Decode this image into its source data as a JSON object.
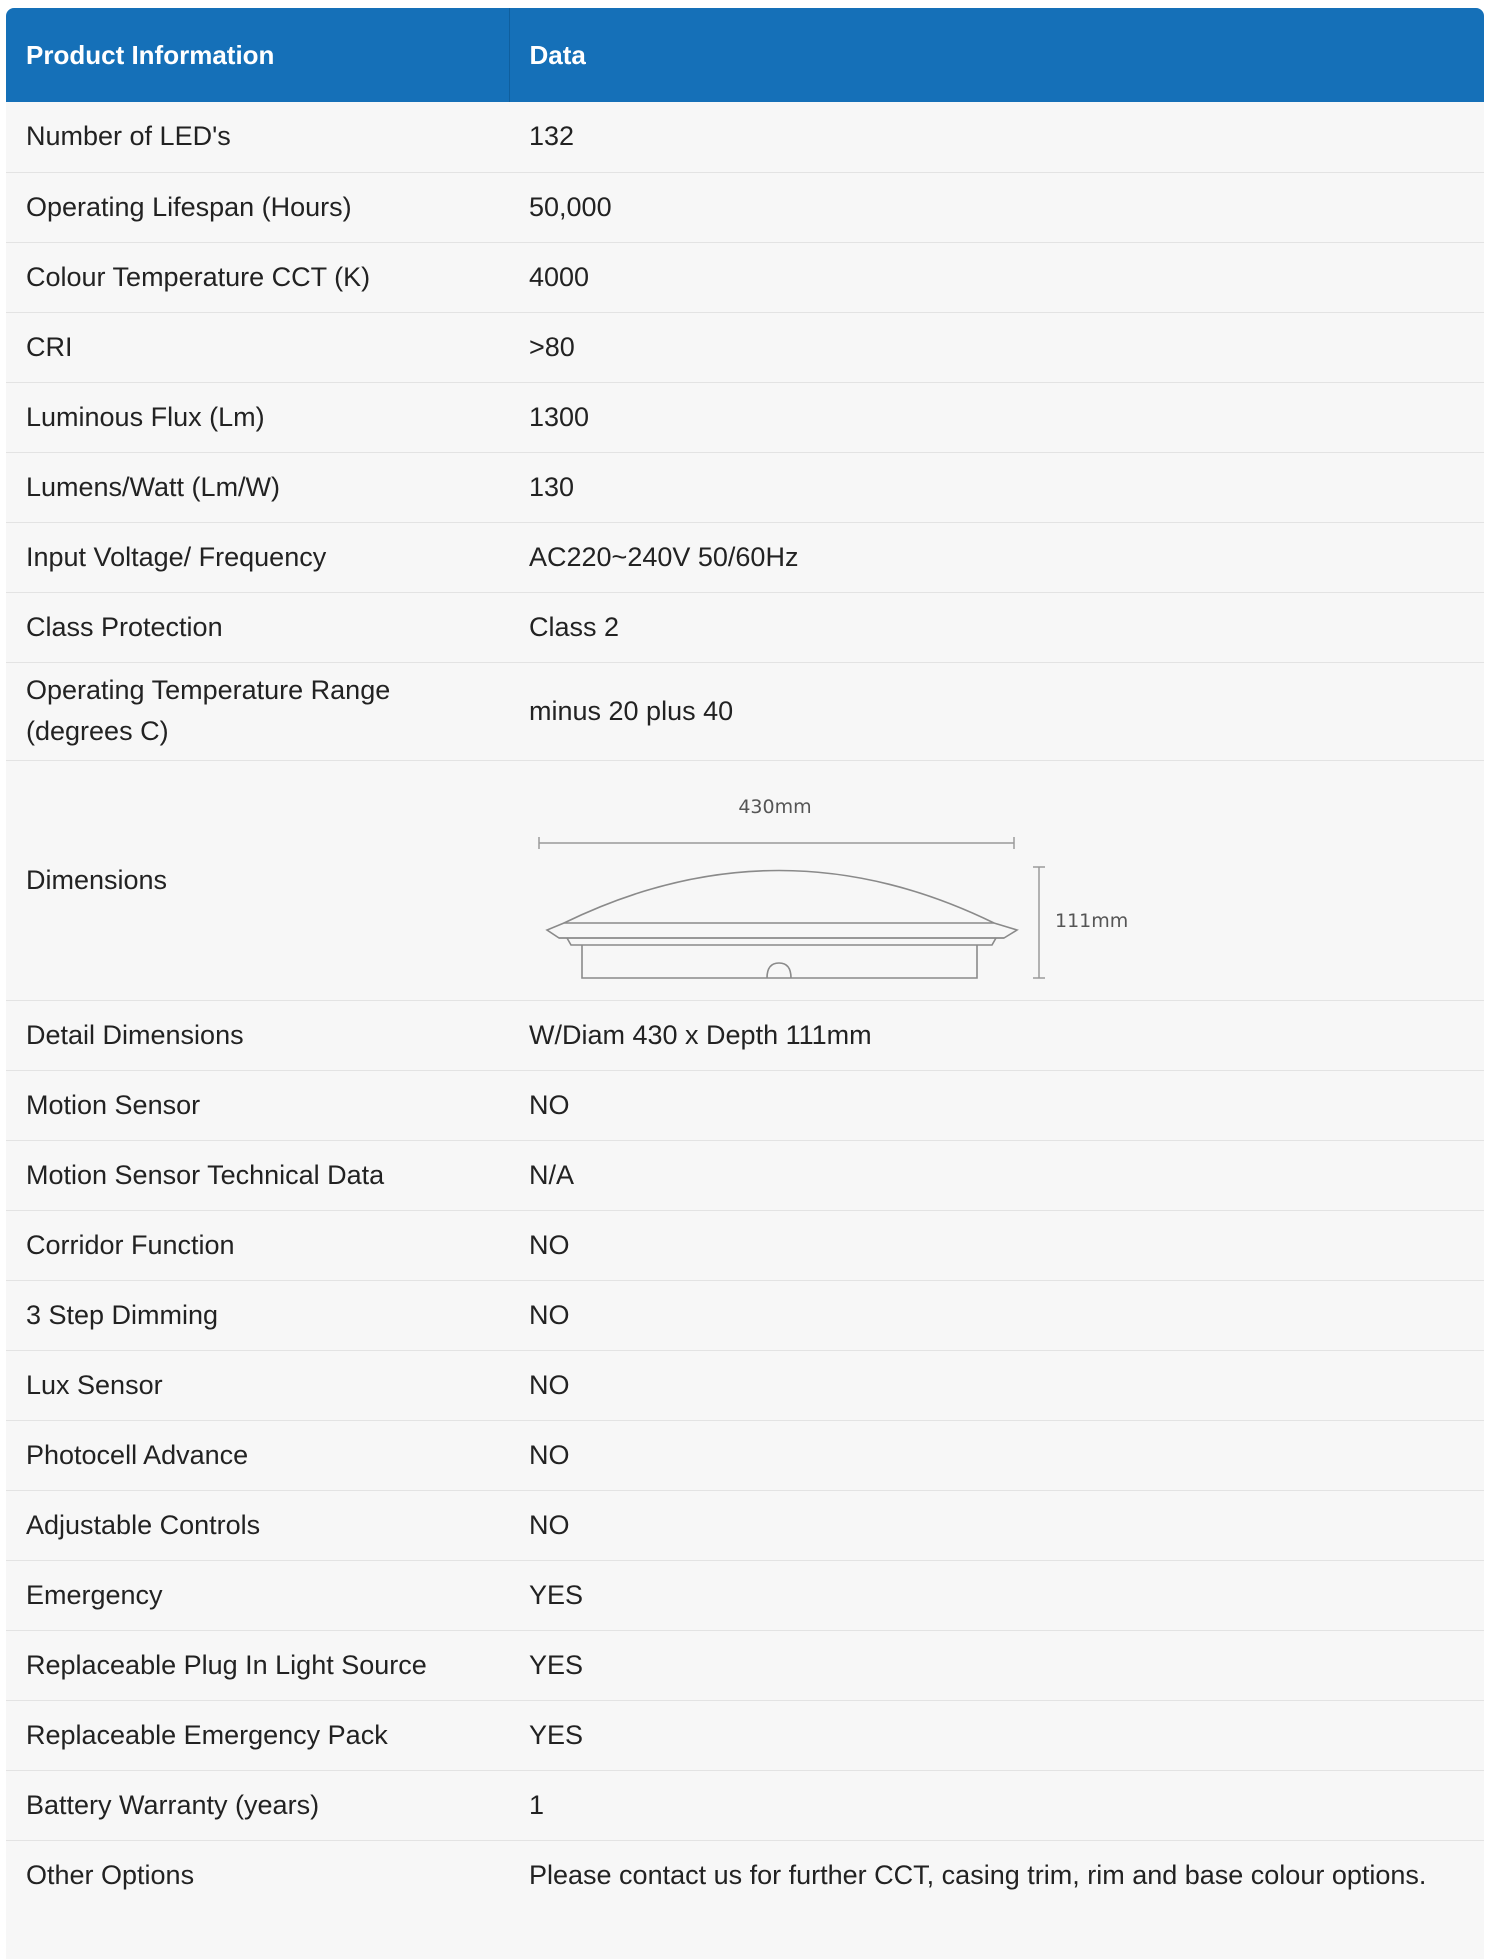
{
  "header": {
    "col1": "Product Information",
    "col2": "Data"
  },
  "rows": [
    {
      "label": "Number of LED's",
      "value": "132"
    },
    {
      "label": "Operating Lifespan (Hours)",
      "value": "50,000"
    },
    {
      "label": "Colour Temperature CCT (K)",
      "value": "4000"
    },
    {
      "label": "CRI",
      "value": ">80"
    },
    {
      "label": "Luminous Flux (Lm)",
      "value": "1300"
    },
    {
      "label": "Lumens/Watt (Lm/W)",
      "value": "130"
    },
    {
      "label": "Input Voltage/ Frequency",
      "value": "AC220~240V 50/60Hz"
    },
    {
      "label": "Class Protection",
      "value": "Class 2"
    },
    {
      "label": "Operating Temperature Range (degrees C)",
      "value": "minus 20 plus 40"
    },
    {
      "label": "Dimensions",
      "diagram": {
        "width_label": "430mm",
        "height_label": "111mm"
      }
    },
    {
      "label": "Detail Dimensions",
      "value": "W/Diam 430 x Depth 111mm"
    },
    {
      "label": "Motion Sensor",
      "value": "NO"
    },
    {
      "label": "Motion Sensor Technical Data",
      "value": "N/A"
    },
    {
      "label": "Corridor Function",
      "value": "NO"
    },
    {
      "label": "3 Step Dimming",
      "value": "NO"
    },
    {
      "label": "Lux Sensor",
      "value": "NO"
    },
    {
      "label": "Photocell Advance",
      "value": "NO"
    },
    {
      "label": "Adjustable Controls",
      "value": "NO"
    },
    {
      "label": "Emergency",
      "value": "YES"
    },
    {
      "label": "Replaceable Plug In Light Source",
      "value": "YES"
    },
    {
      "label": "Replaceable Emergency Pack",
      "value": "YES"
    },
    {
      "label": "Battery Warranty (years)",
      "value": "1"
    },
    {
      "label": "Other Options",
      "value": "Please contact us for further CCT, casing trim, rim and base colour options."
    }
  ],
  "colors": {
    "header_bg": "#1570b8",
    "header_text": "#ffffff",
    "row_bg": "#f7f7f7",
    "row_border": "#e3e3e3",
    "text": "#222222"
  }
}
